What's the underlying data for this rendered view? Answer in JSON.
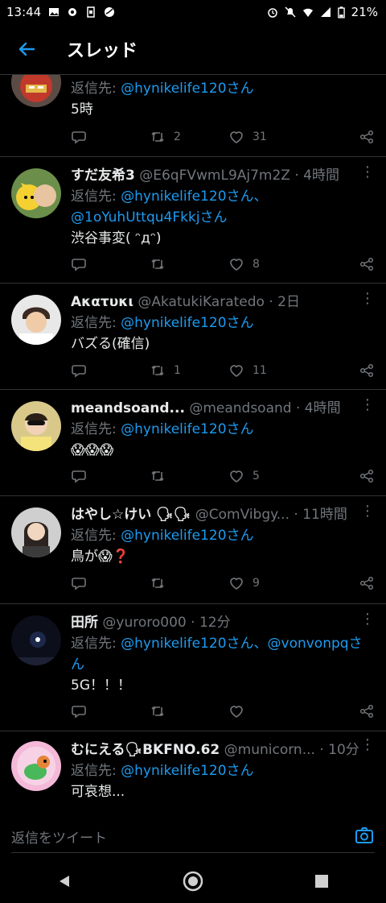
{
  "status": {
    "time": "13:44",
    "battery": "21%"
  },
  "header": {
    "title": "スレッド"
  },
  "tweets": [
    {
      "name": "",
      "handle": "",
      "time": "",
      "reply_prefix": "返信先: ",
      "mentions": "@hynikelife120さん",
      "text": "5時",
      "retweets": "2",
      "likes": "31",
      "avatar": "ironman"
    },
    {
      "name": "すだ友希3",
      "handle": "@E6qFVwmL9Aj7m2Z",
      "time": "· 4時間",
      "reply_prefix": "返信先: ",
      "mentions": "@hynikelife120さん、",
      "mentions2": "@1oYuhUttqu4Fkkjさん",
      "text": "渋谷事変( ᵔдᵔ)",
      "retweets": "",
      "likes": "8",
      "avatar": "pikachu"
    },
    {
      "name": "Ακατυκι",
      "handle": "@AkatukiKaratedo",
      "time": "· 2日",
      "reply_prefix": "返信先: ",
      "mentions": "@hynikelife120さん",
      "text": "バズる(確信)",
      "retweets": "1",
      "likes": "11",
      "avatar": "boy"
    },
    {
      "name": "meandsoand...",
      "handle": "@meandsoand",
      "time": "· 4時間",
      "reply_prefix": "返信先: ",
      "mentions": "@hynikelife120さん",
      "text": "😱😱😱",
      "retweets": "",
      "likes": "5",
      "avatar": "child"
    },
    {
      "name": "はやし☆けい 🗣🗣",
      "handle": "@ComVibgy...",
      "time": "· 11時間",
      "reply_prefix": "返信先: ",
      "mentions": "@hynikelife120さん",
      "text": "鳥が😱❓",
      "retweets": "",
      "likes": "9",
      "avatar": "person"
    },
    {
      "name": "田所",
      "handle": "@yuroro000",
      "time": "· 12分",
      "reply_prefix": "返信先: ",
      "mentions": "@hynikelife120さん、@vonvonpqさ",
      "mentions2": "ん",
      "text": "5G！！！",
      "retweets": "",
      "likes": "",
      "avatar": "night"
    },
    {
      "name": "むにえる🗣BKFNO.62",
      "handle": "@municorn...",
      "time": "· 10分",
      "reply_prefix": "返信先: ",
      "mentions": "@hynikelife120さん",
      "text": "可哀想...",
      "retweets": "",
      "likes": "",
      "avatar": "bird"
    }
  ],
  "composer": {
    "placeholder": "返信をツイート"
  }
}
